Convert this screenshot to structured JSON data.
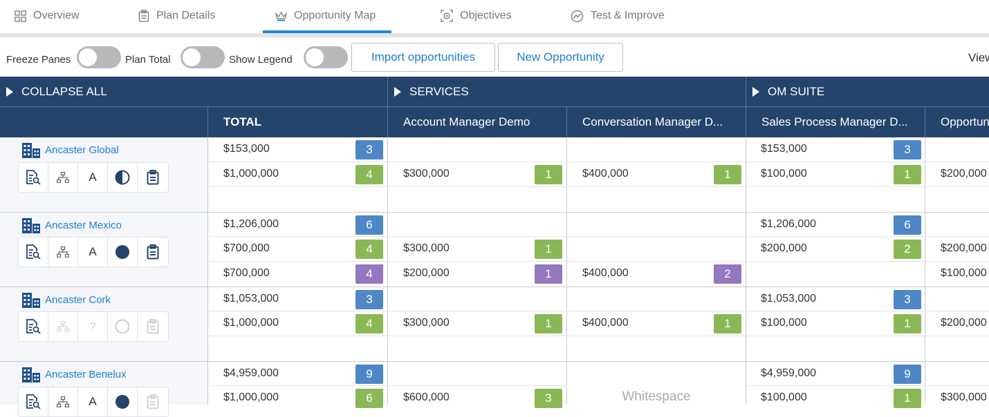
{
  "tabs": [
    {
      "label": "Overview",
      "icon": "grid-icon"
    },
    {
      "label": "Plan Details",
      "icon": "clipboard-icon"
    },
    {
      "label": "Opportunity Map",
      "icon": "crown-icon"
    },
    {
      "label": "Objectives",
      "icon": "target-icon"
    },
    {
      "label": "Test & Improve",
      "icon": "chart-gauge-icon"
    }
  ],
  "toolbar": {
    "freeze_panes": "Freeze Panes",
    "plan_total": "Plan Total",
    "show_legend": "Show Legend",
    "import_btn": "Import opportunities",
    "new_btn": "New Opportunity",
    "view_label": "View"
  },
  "groups": {
    "collapse_all": "COLLAPSE ALL",
    "services": "SERVICES",
    "om_suite": "OM SUITE"
  },
  "columns": {
    "total": "TOTAL",
    "c1": "Account Manager Demo",
    "c2": "Conversation Manager D...",
    "c3": "Sales Process Manager D...",
    "c4": "Opportunity"
  },
  "colors": {
    "header": "#24446b",
    "blue_badge": "#4f86c6",
    "green_badge": "#8bb856",
    "purple_badge": "#9378bf",
    "link": "#1f7ed0"
  },
  "accounts": [
    {
      "name": "Ancaster Global",
      "r": [
        {
          "total": "$153,000",
          "tb": "3",
          "c1": "",
          "c1b": "",
          "c2": "",
          "c2b": "",
          "c3": "$153,000",
          "c3b": "3",
          "c4": ""
        },
        {
          "total": "$1,000,000",
          "tb": "4",
          "c1": "$300,000",
          "c1b": "1",
          "c2": "$400,000",
          "c2b": "1",
          "c3": "$100,000",
          "c3b": "1",
          "c4": "$200,000"
        }
      ]
    },
    {
      "name": "Ancaster Mexico",
      "r": [
        {
          "total": "$1,206,000",
          "tb": "6",
          "c3": "$1,206,000",
          "c3b": "6"
        },
        {
          "total": "$700,000",
          "tb": "4",
          "c1": "$300,000",
          "c1b": "1",
          "c3": "$200,000",
          "c3b": "2",
          "c4": "$200,000"
        },
        {
          "total": "$700,000",
          "tb": "4",
          "c1": "$200,000",
          "c1b": "1",
          "c2": "$400,000",
          "c2b": "2",
          "c4": "$100,000"
        }
      ]
    },
    {
      "name": "Ancaster Cork",
      "r": [
        {
          "total": "$1,053,000",
          "tb": "3",
          "c3": "$1,053,000",
          "c3b": "3"
        },
        {
          "total": "$1,000,000",
          "tb": "4",
          "c1": "$300,000",
          "c1b": "1",
          "c2": "$400,000",
          "c2b": "1",
          "c3": "$100,000",
          "c3b": "1",
          "c4": "$200,000"
        }
      ]
    },
    {
      "name": "Ancaster Benelux",
      "r": [
        {
          "total": "$4,959,000",
          "tb": "9",
          "c3": "$4,959,000",
          "c3b": "9"
        },
        {
          "total": "$1,000,000",
          "tb": "6",
          "c1": "$600,000",
          "c1b": "3",
          "c3": "$100,000",
          "c3b": "1",
          "c4": "$300,000"
        }
      ]
    }
  ],
  "icon_bar": {
    "letter": "A",
    "unknown": "?"
  },
  "whitespace": "Whitespace"
}
